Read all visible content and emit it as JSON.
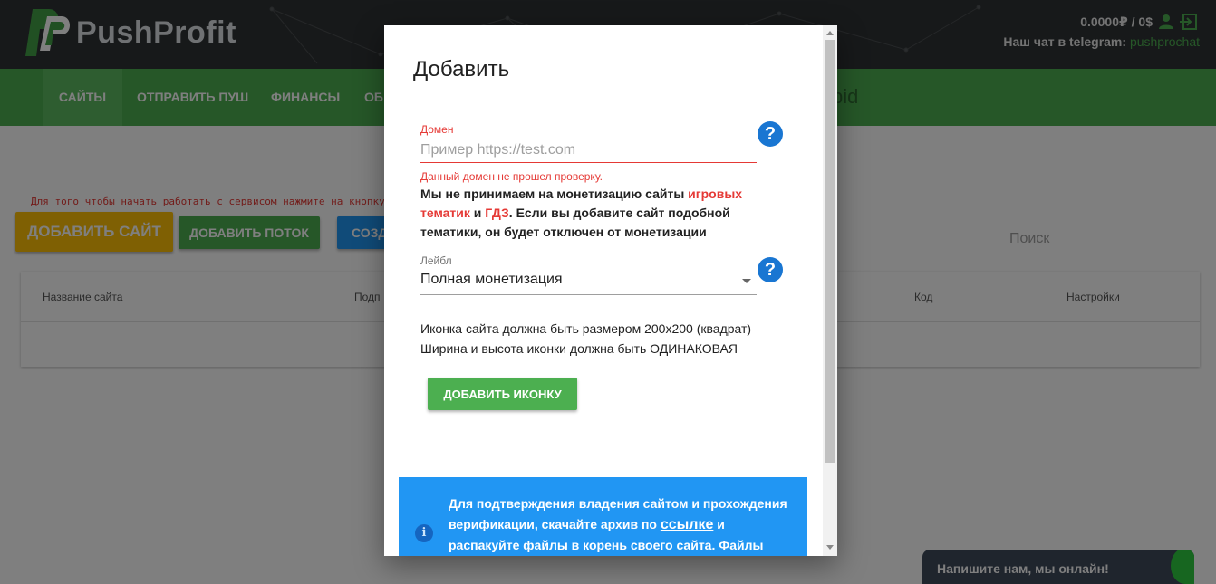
{
  "brand": {
    "name": "PushProfit"
  },
  "header": {
    "balance": "0.0000₽ / 0$",
    "telegram_prefix": "Наш чат в telegram:",
    "telegram_link": "pushprochat"
  },
  "nav": {
    "items": [
      "Сайты",
      "Отправить пуш",
      "Финансы",
      "Об"
    ],
    "right_fragment": "bid"
  },
  "page": {
    "hint": "Для того чтобы начать работать с сервисом нажмите на кнопку",
    "add_site": "Добавить сайт",
    "add_flow": "Добавить поток",
    "create": "Созд",
    "search_label": "Поиск",
    "table_headers": [
      "Название сайта",
      "Подп",
      "Код",
      "Настройки"
    ]
  },
  "modal": {
    "title": "Добавить",
    "domain": {
      "label": "Домен",
      "placeholder": "Пример https://test.com",
      "error": "Данный домен не прошел проверку."
    },
    "warning": {
      "part1": "Мы не принимаем на монетизацию сайты ",
      "highlight1": "игровых тематик",
      "part2": " и ",
      "highlight2": "ГДЗ",
      "part3": ". Если вы добавите сайт подобной тематики, он будет отключен от монетизации"
    },
    "label_field": {
      "label": "Лейбл",
      "value": "Полная монетизация"
    },
    "icon_note_line1": "Иконка сайта должна быть размером 200x200 (квадрат)",
    "icon_note_line2": "Ширина и высота иконки должна быть ОДИНАКОВАЯ",
    "add_icon_button": "Добавить иконку",
    "help_glyph": "?",
    "info": {
      "icon_glyph": "i",
      "text_before": "Для подтверждения владения сайтом и прохождения верификации, скачайте архив по ",
      "link": "ссылке",
      "text_after": " и распакуйте файлы в корень своего сайта. Файлы должны быть"
    }
  },
  "chat_widget": {
    "text": "Напишите нам, мы онлайн!"
  },
  "colors": {
    "green": "#4caf50",
    "yellow": "#ffc107",
    "blue": "#2196f3",
    "error_red": "#e53935",
    "help_blue": "#1976d2",
    "header_dark": "#2f3234"
  }
}
